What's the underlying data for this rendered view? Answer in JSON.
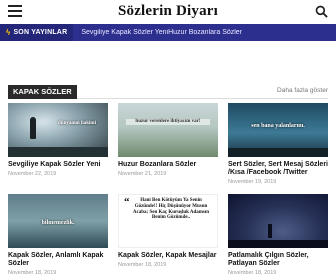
{
  "site": {
    "title": "Sözlerin Diyarı"
  },
  "ticker": {
    "label": "SON YAYINLAR",
    "text": "Sevgiliye Kapak Sözler YeniHuzur Bozanlara Sözler"
  },
  "section": {
    "title": "KAPAK SÖZLER",
    "more": "Daha fazla göster"
  },
  "posts": [
    {
      "title": "Sevgiliye Kapak Sözler Yeni",
      "date": "November 22, 2019",
      "thumb_text": "dünyamın hakimi"
    },
    {
      "title": "Huzur Bozanlara Sözler",
      "date": "November 21, 2019",
      "thumb_text": "huzur verenlere ihtiyacım var!"
    },
    {
      "title": "Sert Sözler, Sert Mesaj Sözleri /Kısa /Facebook /Twitter",
      "date": "November 19, 2019",
      "thumb_text": "sen bana yalanlarını."
    },
    {
      "title": "Kapak Sözler, Anlamlı Kapak Sözler",
      "date": "November 18, 2019",
      "thumb_text": "bilmemezlik."
    },
    {
      "title": "Kapak Sözler, Kapak Mesajlar",
      "date": "November 18, 2019",
      "thumb_text": "Hani Ben Kötüyüm Ya Senin Gözünde!! Hiç Düşünüyor Musun Acaba; Sen Kaç Kuruşluk Adamsın Benim Gözümde.."
    },
    {
      "title": "Patlamalık Çılgın Sözler, Patlayan Sözler",
      "date": "November 18, 2019",
      "thumb_text": ""
    }
  ]
}
